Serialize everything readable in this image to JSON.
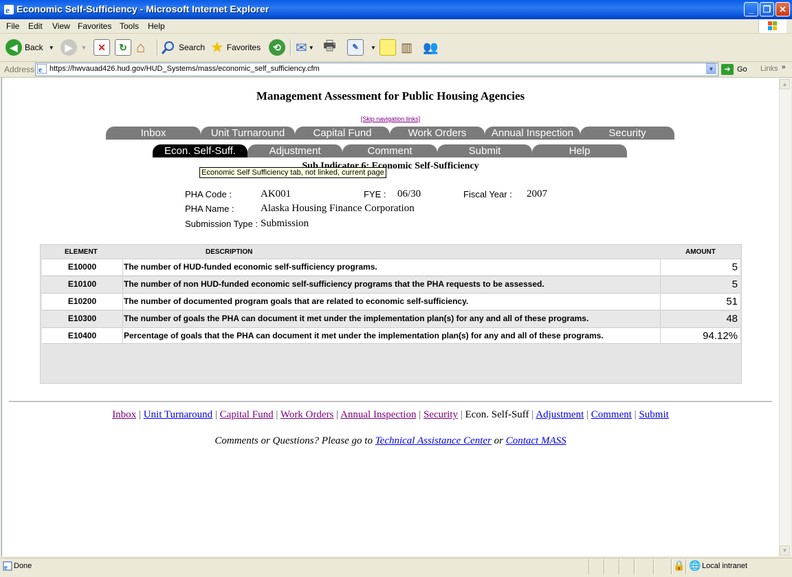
{
  "window": {
    "title": "Economic Self-Sufficiency - Microsoft Internet Explorer",
    "minimize": "_",
    "maximize": "❐",
    "close": "✕"
  },
  "menubar": [
    "File",
    "Edit",
    "View",
    "Favorites",
    "Tools",
    "Help"
  ],
  "toolbar": {
    "back_label": "Back",
    "search_label": "Search",
    "favorites_label": "Favorites"
  },
  "address": {
    "label": "Address",
    "url": "https://hwvauad426.hud.gov/HUD_Systems/mass/economic_self_sufficiency.cfm",
    "go_label": "Go",
    "links_label": "Links"
  },
  "page": {
    "title": "Management Assessment for Public Housing Agencies",
    "skip_link": "[Skip navigation links]",
    "tabs_row1": [
      "Inbox",
      "Unit Turnaround",
      "Capital Fund",
      "Work Orders",
      "Annual Inspection",
      "Security"
    ],
    "tabs_row2": [
      "Econ. Self-Suff.",
      "Adjustment",
      "Comment",
      "Submit",
      "Help"
    ],
    "sub_heading": "Sub Indicator 6: Economic Self-Sufficiency",
    "tooltip": "Economic Self Sufficiency tab, not linked, current page",
    "info": {
      "pha_code_label": "PHA Code :",
      "pha_code": "AK001",
      "fye_label": "FYE :",
      "fye": "06/30",
      "fiscal_year_label": "Fiscal Year :",
      "fiscal_year": "2007",
      "pha_name_label": "PHA Name :",
      "pha_name": "Alaska Housing Finance Corporation",
      "submission_type_label": "Submission Type :",
      "submission_type": "Submission"
    },
    "table": {
      "headers": [
        "ELEMENT",
        "DESCRIPTION",
        "AMOUNT"
      ],
      "rows": [
        {
          "element": "E10000",
          "description": "The number of HUD-funded economic self-sufficiency programs.",
          "amount": "5"
        },
        {
          "element": "E10100",
          "description": "The number of non HUD-funded economic self-sufficiency programs that the PHA requests to be assessed.",
          "amount": "5"
        },
        {
          "element": "E10200",
          "description": "The number of documented program goals that are related to economic self-sufficiency.",
          "amount": "51"
        },
        {
          "element": "E10300",
          "description": "The number of goals the PHA can document it met under the implementation plan(s) for any and all of these programs.",
          "amount": "48"
        },
        {
          "element": "E10400",
          "description": "Percentage of goals that the PHA can document it met under the implementation plan(s) for any and all of these programs.",
          "amount": "94.12%"
        }
      ]
    },
    "footer_nav": {
      "inbox": "Inbox",
      "unit_turnaround": "Unit Turnaround",
      "capital_fund": "Capital Fund",
      "work_orders": "Work Orders",
      "annual_inspection": "Annual Inspection",
      "security": "Security",
      "econ_self_suff": "Econ. Self-Suff",
      "adjustment": "Adjustment",
      "comment": "Comment",
      "submit": "Submit",
      "separator": "|"
    },
    "comments": {
      "prefix": "Comments or Questions? Please go to ",
      "tac_link": "Technical Assistance Center",
      "middle": " or ",
      "contact_link": "Contact MASS"
    }
  },
  "statusbar": {
    "status": "Done",
    "zone": "Local intranet"
  },
  "colors": {
    "titlebar": "#0a5ce8",
    "tab_inactive": "#7b7b7b",
    "tab_active": "#000000",
    "visited_link": "#800080",
    "link": "#0000ee"
  }
}
